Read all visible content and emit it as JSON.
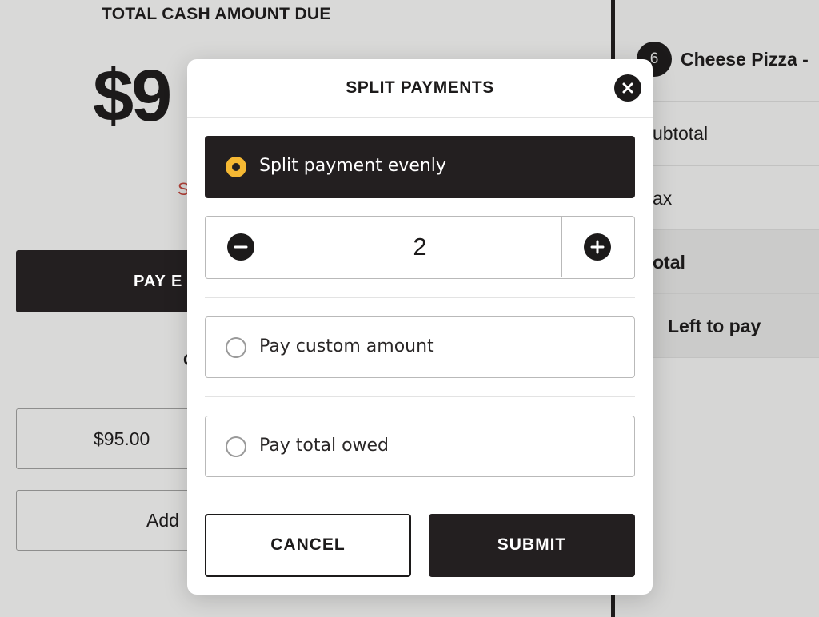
{
  "background": {
    "left": {
      "title": "TOTAL CASH AMOUNT DUE",
      "amount_partial": "$9",
      "red_text_partial": "S",
      "pay_button_partial": "PAY E",
      "divider_text_partial": "O",
      "amount_option": "$95.00",
      "add_option_partial": "Add"
    },
    "right": {
      "item_qty": "6",
      "item_name": "Cheese Pizza -",
      "rows": [
        "ubtotal",
        "ax",
        "otal",
        "Left to pay"
      ]
    }
  },
  "modal": {
    "title": "SPLIT PAYMENTS",
    "options": [
      {
        "label": "Split payment evenly",
        "selected": true
      },
      {
        "label": "Pay custom amount",
        "selected": false
      },
      {
        "label": "Pay total owed",
        "selected": false
      }
    ],
    "split_count": "2",
    "cancel_label": "CANCEL",
    "submit_label": "SUBMIT"
  },
  "colors": {
    "accent_yellow": "#f5b833",
    "dark": "#231f20",
    "red": "#b04038"
  },
  "icons": {
    "close": "close-icon",
    "minus": "minus-icon",
    "plus": "plus-icon"
  }
}
